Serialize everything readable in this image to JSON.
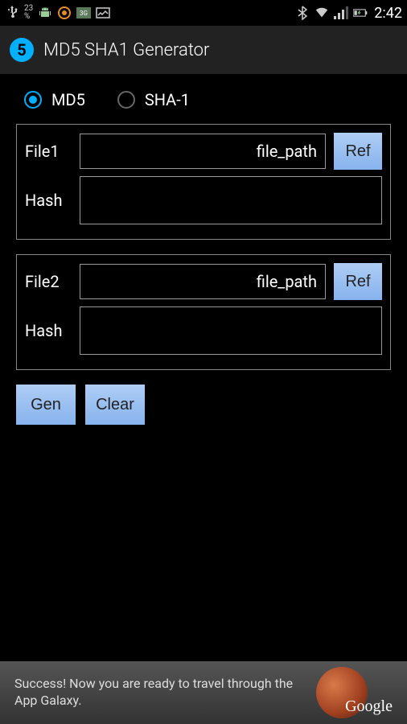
{
  "status_bar": {
    "battery_pct": "23",
    "time": "2:42"
  },
  "app": {
    "icon_text": "5",
    "title": "MD5 SHA1 Generator"
  },
  "radio": {
    "md5_label": "MD5",
    "sha1_label": "SHA-1",
    "selected": "md5"
  },
  "file1": {
    "label": "File1",
    "value": "file_path",
    "ref_label": "Ref",
    "hash_label": "Hash"
  },
  "file2": {
    "label": "File2",
    "value": "file_path",
    "ref_label": "Ref",
    "hash_label": "Hash"
  },
  "actions": {
    "gen_label": "Gen",
    "clear_label": "Clear"
  },
  "ad": {
    "text": "Success! Now you are ready to travel through the App Galaxy.",
    "logo": "Google"
  }
}
